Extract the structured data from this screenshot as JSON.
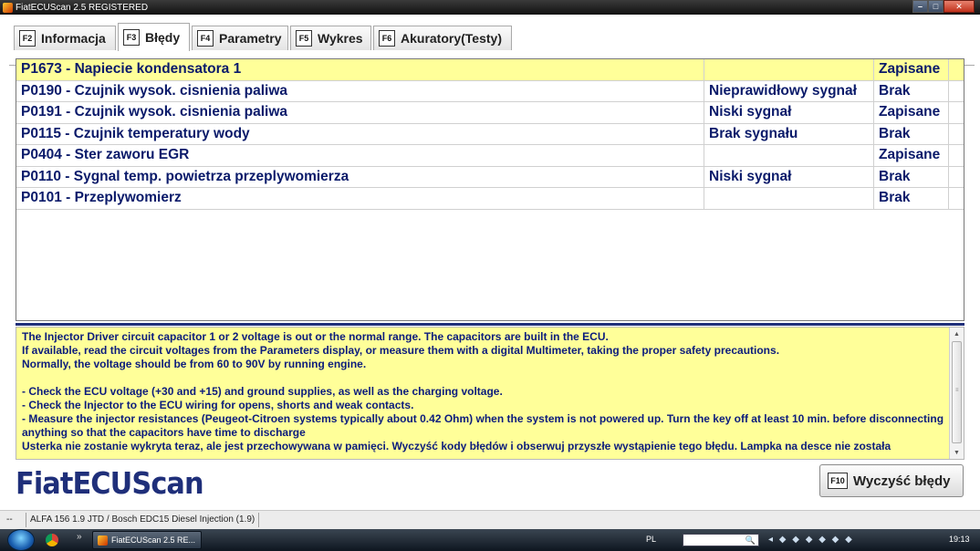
{
  "window": {
    "title": "FiatECUScan 2.5 REGISTERED",
    "min_glyph": "–",
    "max_glyph": "□",
    "close_glyph": "✕"
  },
  "tabs": [
    {
      "key": "F2",
      "label": "Informacja",
      "active": false
    },
    {
      "key": "F3",
      "label": "Błędy",
      "active": true
    },
    {
      "key": "F4",
      "label": "Parametry",
      "active": false
    },
    {
      "key": "F5",
      "label": "Wykres",
      "active": false
    },
    {
      "key": "F6",
      "label": "Akuratory(Testy)",
      "active": false
    }
  ],
  "errors": [
    {
      "code": "P1673 - Napiecie kondensatora 1",
      "desc": "",
      "status": "Zapisane",
      "selected": true
    },
    {
      "code": "P0190 - Czujnik wysok. cisnienia paliwa",
      "desc": "Nieprawidłowy sygnał",
      "status": "Brak",
      "selected": false
    },
    {
      "code": "P0191 - Czujnik wysok. cisnienia paliwa",
      "desc": "Niski sygnał",
      "status": "Zapisane",
      "selected": false
    },
    {
      "code": "P0115 - Czujnik temperatury wody",
      "desc": "Brak sygnału",
      "status": "Brak",
      "selected": false
    },
    {
      "code": "P0404 - Ster zaworu EGR",
      "desc": "",
      "status": "Zapisane",
      "selected": false
    },
    {
      "code": "P0110 - Sygnal temp. powietrza przeplywomierza",
      "desc": "Niski sygnał",
      "status": "Brak",
      "selected": false
    },
    {
      "code": "P0101 - Przeplywomierz",
      "desc": "",
      "status": "Brak",
      "selected": false
    }
  ],
  "info": {
    "lines": [
      "The Injector Driver circuit capacitor 1 or 2 voltage is out or the normal range. The capacitors are built in the ECU.",
      "If available, read the circuit voltages from the Parameters display, or measure them with a digital Multimeter, taking the proper safety precautions.",
      "Normally, the voltage should be from 60 to 90V by running engine.",
      " ",
      "- Check the ECU voltage (+30 and +15) and ground supplies, as well as the charging voltage.",
      "- Check the Injector to the ECU wiring for opens, shorts and weak contacts.",
      "- Measure the injector resistances (Peugeot-Citroen systems typically about 0.42 Ohm) when the system is not powered up. Turn the key off at least 10 min. before disconnecting anything so that the capacitors have time to discharge",
      "Usterka nie zostanie wykryta teraz, ale jest przechowywana w pamięci. Wyczyść kody błędów i obserwuj przyszłe wystąpienie tego błędu. Lampka na desce nie została"
    ]
  },
  "logo": "FiatECUScan",
  "clear_button": {
    "key": "F10",
    "label": "Wyczyść błędy"
  },
  "statusbar": {
    "left": "--",
    "vehicle": "ALFA 156 1.9 JTD / Bosch EDC15 Diesel Injection (1.9)"
  },
  "taskbar": {
    "chevron": "»",
    "task_label": "FiatECUScan 2.5 RE...",
    "lang": "PL",
    "search_glyph": "🔍",
    "clock": "19:13"
  }
}
